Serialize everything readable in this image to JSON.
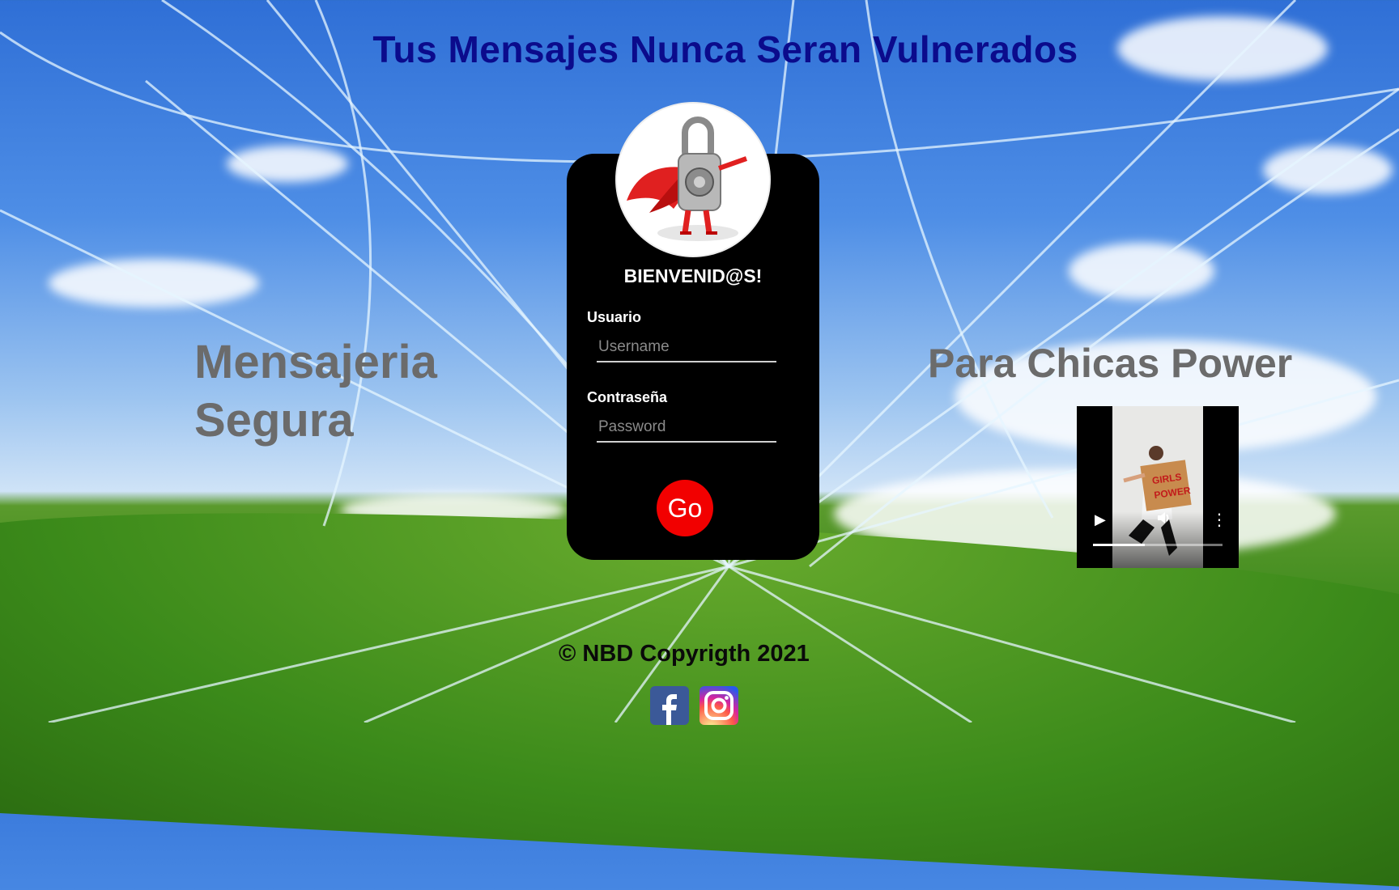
{
  "header": {
    "title": "Tus Mensajes Nunca Seran Vulnerados"
  },
  "left_panel": {
    "line1": "Mensajeria",
    "line2": "Segura"
  },
  "right_panel": {
    "title": "Para Chicas Power"
  },
  "login": {
    "welcome": "BIENVENID@S!",
    "username_label": "Usuario",
    "username_placeholder": "Username",
    "username_value": "",
    "password_label": "Contraseña",
    "password_placeholder": "Password",
    "password_value": "",
    "submit_label": "Go",
    "avatar_icon": "superhero-padlock-icon"
  },
  "video": {
    "poster_text_line1": "GIRLS",
    "poster_text_line2": "POWER",
    "progress": 0.4,
    "play_icon": "play-icon",
    "volume_icon": "volume-icon",
    "menu_icon": "more-vert-icon"
  },
  "footer": {
    "copyright": "©   NBD Copyrigth 2021"
  },
  "social": [
    {
      "name": "facebook",
      "icon": "facebook-icon",
      "color": "#3b5998"
    },
    {
      "name": "instagram",
      "icon": "instagram-icon",
      "color": "#d6249f"
    }
  ],
  "colors": {
    "title": "#0b0b8c",
    "side_text": "#6b6b6b",
    "card": "#000000",
    "button": "#f20000"
  }
}
